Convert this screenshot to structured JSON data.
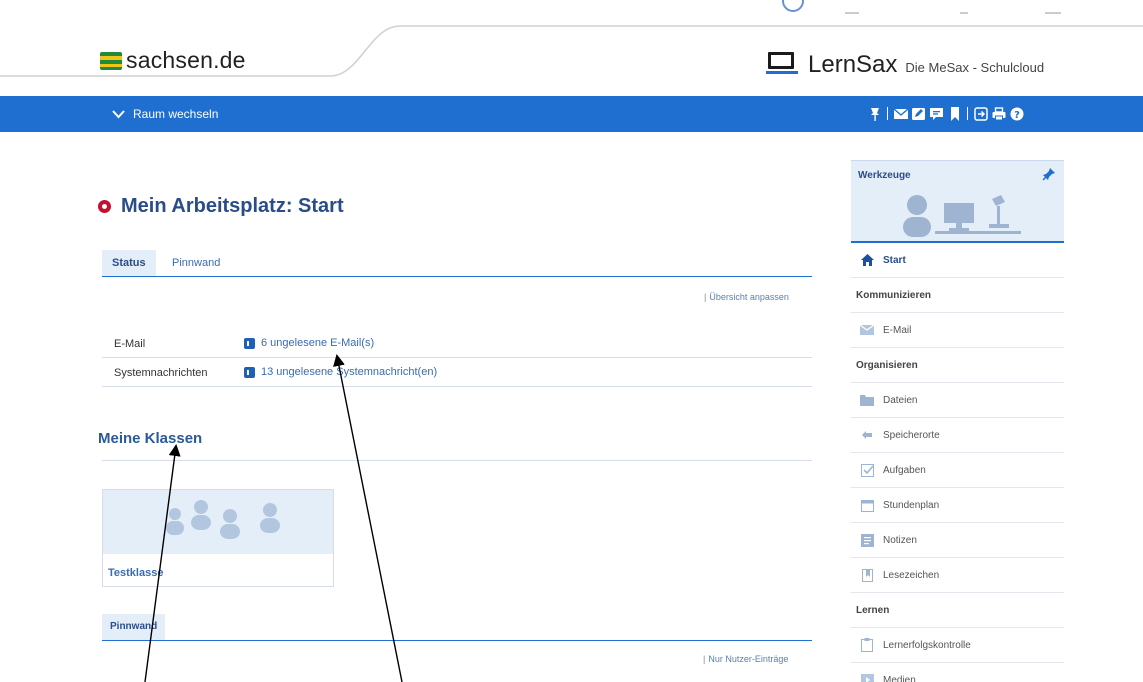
{
  "header": {
    "site_name": "sachsen.de",
    "app_name": "LernSax",
    "app_tagline": "Die MeSax - Schulcloud"
  },
  "toolbar": {
    "room_switch_label": "Raum wechseln",
    "icons": [
      "pin-icon",
      "mail-icon",
      "edit-icon",
      "chat-icon",
      "bookmark-icon",
      "logout-icon",
      "print-icon",
      "help-icon"
    ]
  },
  "main": {
    "title": "Mein Arbeitsplatz: Start",
    "tabs": [
      {
        "label": "Status",
        "active": true
      },
      {
        "label": "Pinnwand",
        "active": false
      }
    ],
    "customize_link": "Übersicht anpassen",
    "status_rows": [
      {
        "label": "E-Mail",
        "value": "6 ungelesene E-Mail(s)"
      },
      {
        "label": "Systemnachrichten",
        "value": "13 ungelesene Systemnachricht(en)"
      }
    ],
    "classes_title": "Meine Klassen",
    "classes": [
      {
        "name": "Testklasse"
      }
    ],
    "pinboard_tab": "Pinnwand",
    "user_entries_link": "Nur Nutzer-Einträge"
  },
  "sidebar": {
    "title": "Werkzeuge",
    "items": [
      {
        "type": "item",
        "label": "Start",
        "icon": "home-icon",
        "active": true
      },
      {
        "type": "category",
        "label": "Kommunizieren"
      },
      {
        "type": "item",
        "label": "E-Mail",
        "icon": "mail-icon"
      },
      {
        "type": "category",
        "label": "Organisieren"
      },
      {
        "type": "item",
        "label": "Dateien",
        "icon": "folder-icon"
      },
      {
        "type": "item",
        "label": "Speicherorte",
        "icon": "storage-icon"
      },
      {
        "type": "item",
        "label": "Aufgaben",
        "icon": "checkbox-icon"
      },
      {
        "type": "item",
        "label": "Stundenplan",
        "icon": "calendar-icon"
      },
      {
        "type": "item",
        "label": "Notizen",
        "icon": "notes-icon"
      },
      {
        "type": "item",
        "label": "Lesezeichen",
        "icon": "bookmark-icon"
      },
      {
        "type": "category",
        "label": "Lernen"
      },
      {
        "type": "item",
        "label": "Lernerfolgskontrolle",
        "icon": "clipboard-icon"
      },
      {
        "type": "item",
        "label": "Medien",
        "icon": "media-icon"
      }
    ]
  },
  "colors": {
    "brand_blue": "#1e6fd0",
    "title_blue": "#2a4d8a",
    "accent_red": "#c8102e",
    "light_blue_bg": "#e4eef9"
  }
}
